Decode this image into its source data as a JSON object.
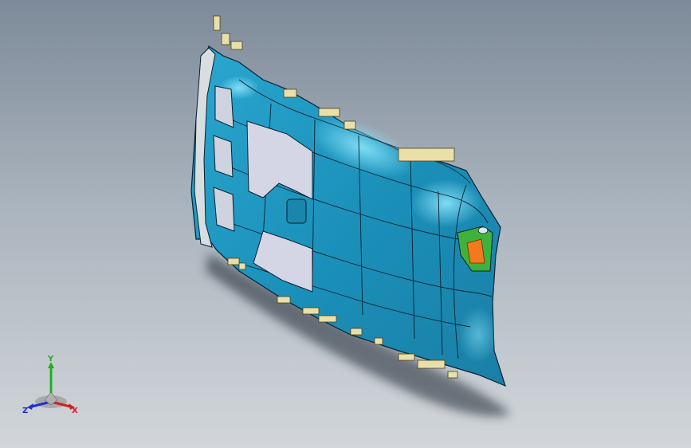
{
  "viewport": {
    "background_top": "#7d8a99",
    "background_bottom": "#d2d6da",
    "model": {
      "part_color": "#1e96be",
      "part_highlight": "#5fd0ef",
      "edge_color": "#0a2030",
      "cutout_color": "#d4d6e6",
      "trim_color": "#e8e0a8",
      "handle_frame_color": "#3fb23c",
      "handle_fill_color": "#f07a1c"
    }
  },
  "triad": {
    "x_label": "X",
    "y_label": "Y",
    "z_label": "Z",
    "x_color": "#d02020",
    "y_color": "#20b020",
    "z_color": "#2030d0"
  }
}
